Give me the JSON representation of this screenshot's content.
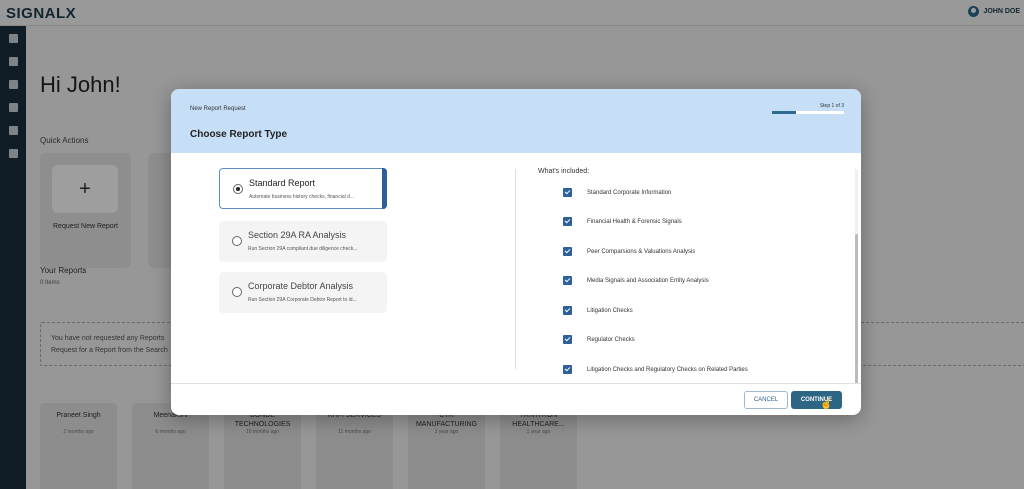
{
  "app": {
    "logo": "SIGNALX",
    "user_name": "JOHN DOE"
  },
  "sidebar": {
    "icons": [
      "dashboard-icon",
      "document-icon",
      "list-icon",
      "gear-icon",
      "user-icon",
      "folder-icon"
    ]
  },
  "dashboard": {
    "greeting": "Hi John!",
    "quick_actions_label": "Quick Actions",
    "request_new_report_label": "Request New Report",
    "your_reports_label": "Your Reports",
    "your_reports_count": "0 Items",
    "empty_message": "You have not requested any Reports Request for a Report from the Search",
    "reports": [
      {
        "name": "Praneet Singh",
        "time": "2 months ago"
      },
      {
        "name": "Meenakshi",
        "time": "6 months ago"
      },
      {
        "name": "BONDE TECHNOLOGIES",
        "time": "10 months ago"
      },
      {
        "name": "KHFI SERVICES",
        "time": "11 months ago"
      },
      {
        "name": "CTR MANUFACTURING",
        "time": "1 year ago"
      },
      {
        "name": "TRIVITRON HEALTHCARE...",
        "time": "1 year ago"
      }
    ]
  },
  "modal": {
    "subtitle": "New Report Request",
    "title": "Choose Report Type",
    "step_label": "Step 1 of 3",
    "step_progress": 0.33,
    "options": [
      {
        "title": "Standard Report",
        "desc": "Automate business history checks, financial d...",
        "selected": true
      },
      {
        "title": "Section 29A RA Analysis",
        "desc": "Run Section 29A compliant due diligence check...",
        "selected": false
      },
      {
        "title": "Corporate Debtor Analysis",
        "desc": "Run Section 29A Corporate Debtor Report to id...",
        "selected": false
      }
    ],
    "included_title": "What's included:",
    "included_items": [
      "Standard Corporate Information",
      "Financial Health & Forensic Signals",
      "Peer Comparsions & Valuations Analysis",
      "Media Signals and Association Entity Analysis",
      "Litigation Checks",
      "Regulator Checks",
      "Litigation Checks and Regulatory Checks on Related Parties"
    ],
    "cancel_label": "CANCEL",
    "continue_label": "CONTINUE"
  },
  "colors": {
    "accent": "#2d6585",
    "header_bg": "#c6dff7",
    "sidebar_bg": "#1a2f3f"
  }
}
